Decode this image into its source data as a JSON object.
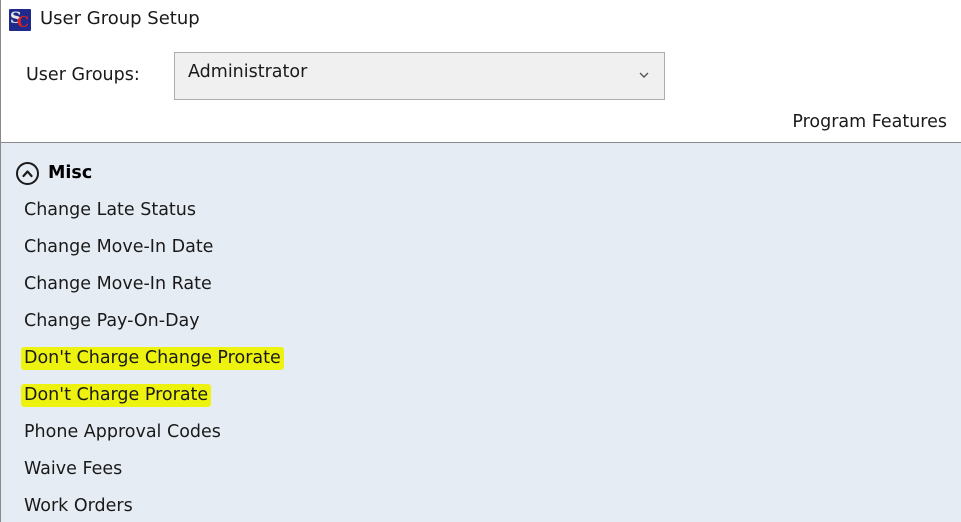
{
  "window": {
    "title": "User Group Setup",
    "icon": "sc-app-icon",
    "icon_letters": "SC",
    "colors": {
      "icon_background": "#1f2a8c",
      "icon_accent": "#e0231c"
    }
  },
  "user_groups": {
    "label": "User Groups:",
    "selected": "Administrator",
    "dropdown_icon": "chevron-down-icon"
  },
  "features": {
    "header": "Program Features",
    "panel_background": "#e6ecf4",
    "highlight_color": "#eef20f",
    "sections": [
      {
        "title": "Misc",
        "expanded": true,
        "toggle_icon": "chevron-up-circle-icon",
        "items": [
          {
            "label": "Change Late Status",
            "highlighted": false
          },
          {
            "label": "Change Move-In Date",
            "highlighted": false
          },
          {
            "label": "Change Move-In Rate",
            "highlighted": false
          },
          {
            "label": "Change Pay-On-Day",
            "highlighted": false
          },
          {
            "label": "Don't Charge Change Prorate",
            "highlighted": true
          },
          {
            "label": "Don't Charge Prorate",
            "highlighted": true
          },
          {
            "label": "Phone Approval Codes",
            "highlighted": false
          },
          {
            "label": "Waive Fees",
            "highlighted": false
          },
          {
            "label": "Work Orders",
            "highlighted": false
          }
        ]
      }
    ]
  }
}
